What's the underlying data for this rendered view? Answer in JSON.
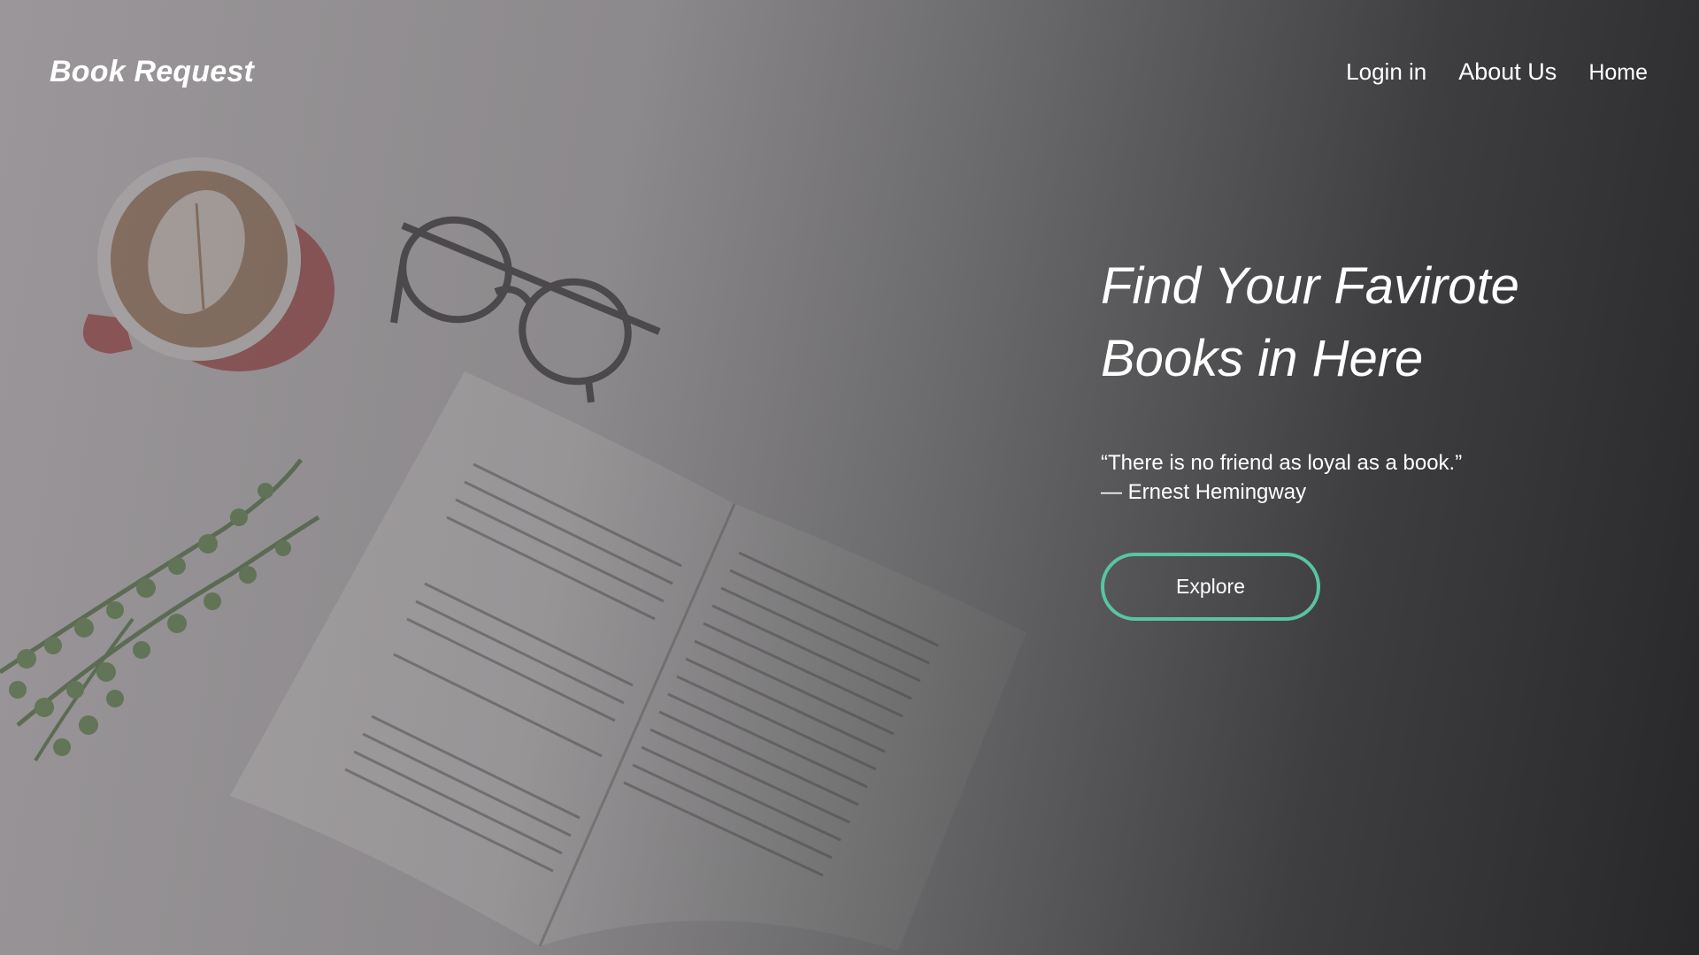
{
  "header": {
    "brand": "Book Request",
    "nav": [
      {
        "label": "Login in"
      },
      {
        "label": "About Us"
      },
      {
        "label": "Home"
      }
    ]
  },
  "hero": {
    "title_line1": "Find Your Favirote",
    "title_line2": "Books in Here",
    "quote_text": "“There is no friend as loyal as a book.”",
    "quote_author": "— Ernest Hemingway",
    "cta_label": "Explore"
  },
  "colors": {
    "accent": "#5ac4a0",
    "text": "#ffffff",
    "overlay_dark": "#242426"
  }
}
